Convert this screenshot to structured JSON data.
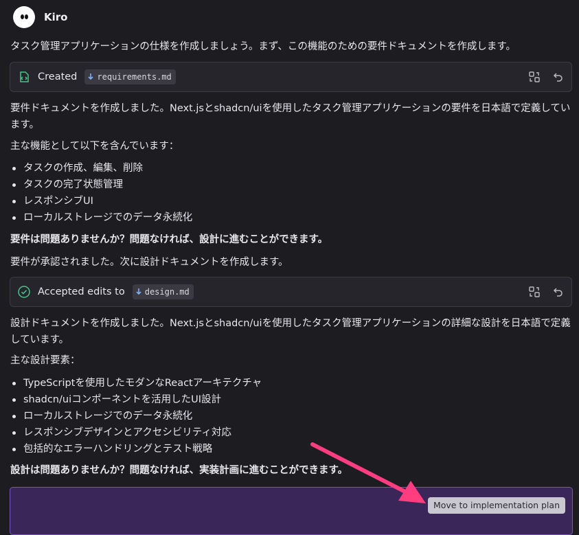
{
  "header": {
    "title": "Kiro",
    "avatar_icon": "kiro-ghost-icon"
  },
  "intro": "タスク管理アプリケーションの仕様を作成しましょう。まず、この機能のための要件ドキュメントを作成します。",
  "card1": {
    "label": "Created",
    "file": "requirements.md",
    "status_icon": "file-created-icon",
    "actions": [
      "compare-icon",
      "undo-icon"
    ]
  },
  "requirements": {
    "summary": "要件ドキュメントを作成しました。Next.jsとshadcn/uiを使用したタスク管理アプリケーションの要件を日本語で定義しています。",
    "features_intro": "主な機能として以下を含んでいます：",
    "features": [
      "タスクの作成、編集、削除",
      "タスクの完了状態管理",
      "レスポンシブUI",
      "ローカルストレージでのデータ永続化"
    ],
    "question": "要件は問題ありませんか？問題なければ、設計に進むことができます。",
    "approved": "要件が承認されました。次に設計ドキュメントを作成します。"
  },
  "card2": {
    "label": "Accepted edits to",
    "file": "design.md",
    "status_icon": "check-circle-icon",
    "actions": [
      "compare-icon",
      "undo-icon"
    ]
  },
  "design": {
    "summary": "設計ドキュメントを作成しました。Next.jsとshadcn/uiを使用したタスク管理アプリケーションの詳細な設計を日本語で定義しています。",
    "elements_intro": "主な設計要素：",
    "elements": [
      "TypeScriptを使用したモダンなReactアーキテクチャ",
      "shadcn/uiコンポーネントを活用したUI設計",
      "ローカルストレージでのデータ永続化",
      "レスポンシブデザインとアクセシビリティ対応",
      "包括的なエラーハンドリングとテスト戦略"
    ],
    "question": "設計は問題ありませんか？問題なければ、実装計画に進むことができます。"
  },
  "action_panel": {
    "button_label": "Move to implementation plan"
  },
  "colors": {
    "background": "#1d1c21",
    "panel": "#3a2659",
    "panel_border": "#7a55bd",
    "arrow": "#ff3d7f",
    "success": "#4cc38a"
  }
}
